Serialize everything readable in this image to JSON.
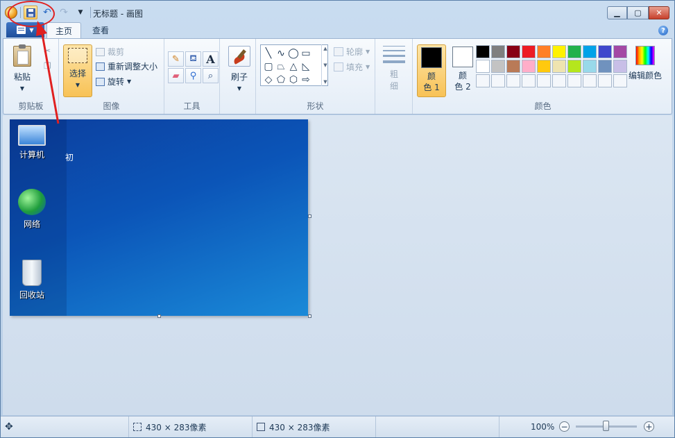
{
  "window": {
    "title": "无标题 - 画图"
  },
  "tabs": {
    "home": "主页",
    "view": "查看"
  },
  "clipboard": {
    "paste": "粘贴",
    "group": "剪贴板"
  },
  "image": {
    "select": "选择",
    "crop": "裁剪",
    "resize": "重新调整大小",
    "rotate": "旋转",
    "group": "图像"
  },
  "tools": {
    "group": "工具",
    "text_glyph": "A"
  },
  "brushes": {
    "label": "刷子"
  },
  "shapes": {
    "outline": "轮廓",
    "fill": "填充",
    "group": "形状"
  },
  "size": {
    "line1": "粗",
    "line2": "细"
  },
  "colors": {
    "color1_line1": "颜",
    "color1_line2": "色 1",
    "color2_line1": "颜",
    "color2_line2": "色 2",
    "edit": "编辑颜色",
    "group": "颜色",
    "color1_value": "#000000",
    "color2_value": "#ffffff",
    "palette": [
      "#000000",
      "#7f7f7f",
      "#880015",
      "#ed1c24",
      "#ff7f27",
      "#fff200",
      "#22b14c",
      "#00a2e8",
      "#3f48cc",
      "#a349a4",
      "#ffffff",
      "#c3c3c3",
      "#b97a57",
      "#ffaec9",
      "#ffc90e",
      "#efe4b0",
      "#b5e61d",
      "#99d9ea",
      "#7092be",
      "#c8bfe7"
    ]
  },
  "desktop": {
    "computer": "计算机",
    "network": "网络",
    "recycle": "回收站",
    "cut_char": "初"
  },
  "status": {
    "selection_size": "430 × 283像素",
    "image_size": "430 × 283像素",
    "zoom": "100%"
  }
}
